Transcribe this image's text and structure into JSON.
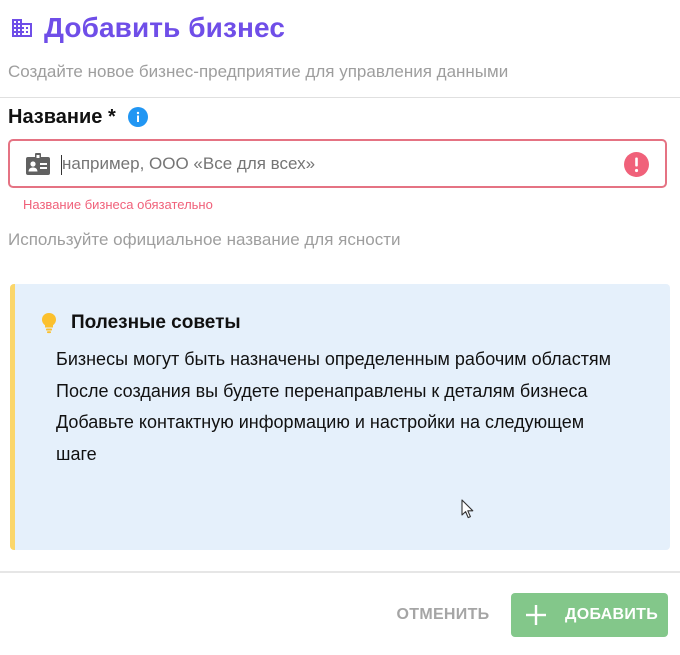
{
  "header": {
    "icon": "building-icon",
    "title": "Добавить бизнес",
    "subtitle": "Создайте новое бизнес-предприятие для управления данными"
  },
  "form": {
    "name_label": "Название *",
    "label_icon": "info-icon",
    "name_input": {
      "value": "",
      "placeholder": "например, ООО «Все для всех»",
      "leading_icon": "id-badge-icon",
      "trailing_icon": "error-icon"
    },
    "error_message": "Название бизнеса обязательно",
    "helper_text": "Используйте официальное название для ясности"
  },
  "tips": {
    "icon": "lightbulb-icon",
    "title": "Полезные советы",
    "items": [
      "Бизнесы могут быть назначены определенным рабочим областям",
      "После создания вы будете перенаправлены к деталям бизнеса",
      "Добавьте контактную информацию и настройки на следующем шаге"
    ]
  },
  "actions": {
    "cancel_label": "ОТМЕНИТЬ",
    "add_label": "ДОБАВИТЬ",
    "add_icon": "plus-icon"
  },
  "colors": {
    "accent": "#6f4ee8",
    "error": "#e57383",
    "tips_background": "#e5f0fb",
    "tips_border": "#fbd66a",
    "add_button": "#83c78a",
    "info_icon": "#2196f3"
  }
}
